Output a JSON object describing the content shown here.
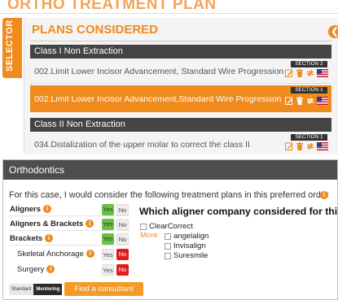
{
  "top": {
    "heading": "ORTHO TREATMENT PLAN",
    "selector_label": "SELECTOR",
    "plans_title": "PLANS CONSIDERED",
    "groups": [
      {
        "name": "Class I Non Extraction",
        "plans": [
          {
            "label": "002.Limit Lower Incisor Advancement, Standard Wire Progression",
            "section": "SECTION 2",
            "selected": false
          },
          {
            "label": "002.Limit Lower Incisor Advancement,Standard Wire Progression",
            "section": "SECTION 1",
            "selected": true
          }
        ]
      },
      {
        "name": "Class II Non Extraction",
        "plans": [
          {
            "label": "034.Distalization of the upper molar to correct the class II",
            "section": "SECTION 1",
            "selected": false
          }
        ]
      }
    ],
    "row_icons": [
      "edit-icon",
      "trash-icon",
      "swap-icon",
      "us-flag-icon"
    ]
  },
  "ortho": {
    "header": "Orthodontics",
    "consider_text": "For this case, I would consider the following treatment plans in this preferred order",
    "treatments": [
      {
        "label": "Aligners",
        "bold": true,
        "yes": "Yes",
        "no": "No",
        "state": "yes"
      },
      {
        "label": "Aligners & Brackets",
        "bold": true,
        "yes": "Yes",
        "no": "No",
        "state": "yes"
      },
      {
        "label": "Brackets",
        "bold": true,
        "yes": "Yes",
        "no": "No",
        "state": "yes"
      },
      {
        "label": "Skeletal Anchorage",
        "bold": false,
        "yes": "Yes",
        "no": "No",
        "state": "no"
      },
      {
        "label": "Surgery",
        "bold": false,
        "yes": "Yes",
        "no": "No",
        "state": "no"
      }
    ],
    "aligner_question": "Which aligner company considered for this case?",
    "aligner_options": [
      "ClearCorrect",
      "angelalign",
      "Invisalign",
      "Suresmile"
    ],
    "more_label": "More",
    "toggle": {
      "standard": "Standard",
      "mentoring": "Mentoring",
      "active": "mentoring"
    },
    "consultant_button": "Find a consultant"
  },
  "colors": {
    "accent_orange": "#f08a1c",
    "header_dark": "#444444",
    "yes_green": "#6cc04a",
    "no_red": "#e01b1b"
  }
}
